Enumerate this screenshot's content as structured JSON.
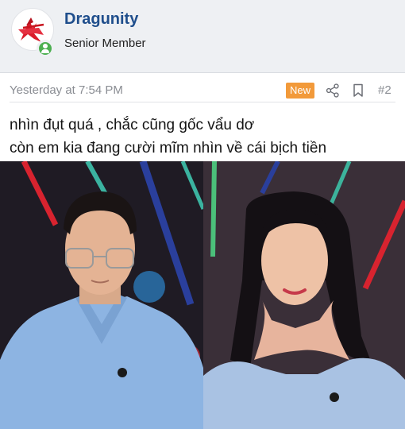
{
  "post": {
    "author": {
      "username": "Dragunity",
      "title": "Senior Member",
      "avatar_icon": "red-logo-icon",
      "status_icon": "online-user-icon",
      "status_color": "#4caf50"
    },
    "meta": {
      "timestamp": "Yesterday at 7:54 PM",
      "badge": "New",
      "badge_color": "#f29a3a",
      "share_icon": "share-icon",
      "bookmark_icon": "bookmark-icon",
      "post_number": "#2"
    },
    "content": {
      "lines": [
        "nhìn đụt quá , chắc cũng gốc vẩu dơ",
        "còn em kia đang cười mĩm nhìn về cái bịch tiền"
      ]
    },
    "image": {
      "left_panel": "man-portrait",
      "right_panel": "woman-portrait"
    }
  }
}
